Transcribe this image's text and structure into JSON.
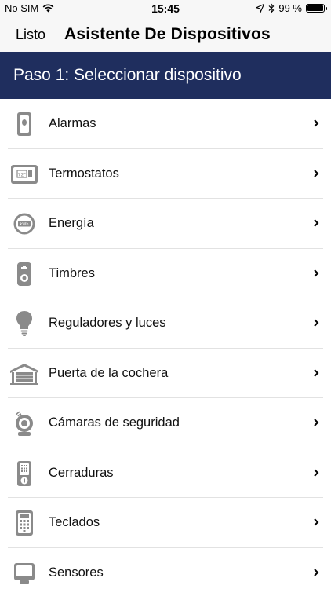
{
  "status_bar": {
    "carrier": "No SIM",
    "time": "15:45",
    "battery_text": "99 %",
    "battery_level": 0.99,
    "icons": [
      "wifi-icon",
      "location-arrow-icon",
      "bluetooth-icon",
      "battery-icon"
    ]
  },
  "nav": {
    "done_label": "Listo",
    "title": "Asistente De Dispositivos"
  },
  "step": {
    "title": "Paso 1: Seleccionar dispositivo"
  },
  "colors": {
    "header_bg": "#1f2e5e",
    "icon_gray": "#8a8a8a",
    "separator": "#e2e2e2"
  },
  "devices": [
    {
      "label": "Alarmas",
      "icon": "alarm-panel-icon"
    },
    {
      "label": "Termostatos",
      "icon": "thermostat-icon"
    },
    {
      "label": "Energía",
      "icon": "energy-meter-icon"
    },
    {
      "label": "Timbres",
      "icon": "doorbell-icon"
    },
    {
      "label": "Reguladores y luces",
      "icon": "light-bulb-icon"
    },
    {
      "label": "Puerta de la cochera",
      "icon": "garage-door-icon"
    },
    {
      "label": "Cámaras de seguridad",
      "icon": "security-camera-icon"
    },
    {
      "label": "Cerraduras",
      "icon": "door-lock-icon"
    },
    {
      "label": "Teclados",
      "icon": "keypad-icon"
    },
    {
      "label": "Sensores",
      "icon": "sensor-icon"
    }
  ]
}
